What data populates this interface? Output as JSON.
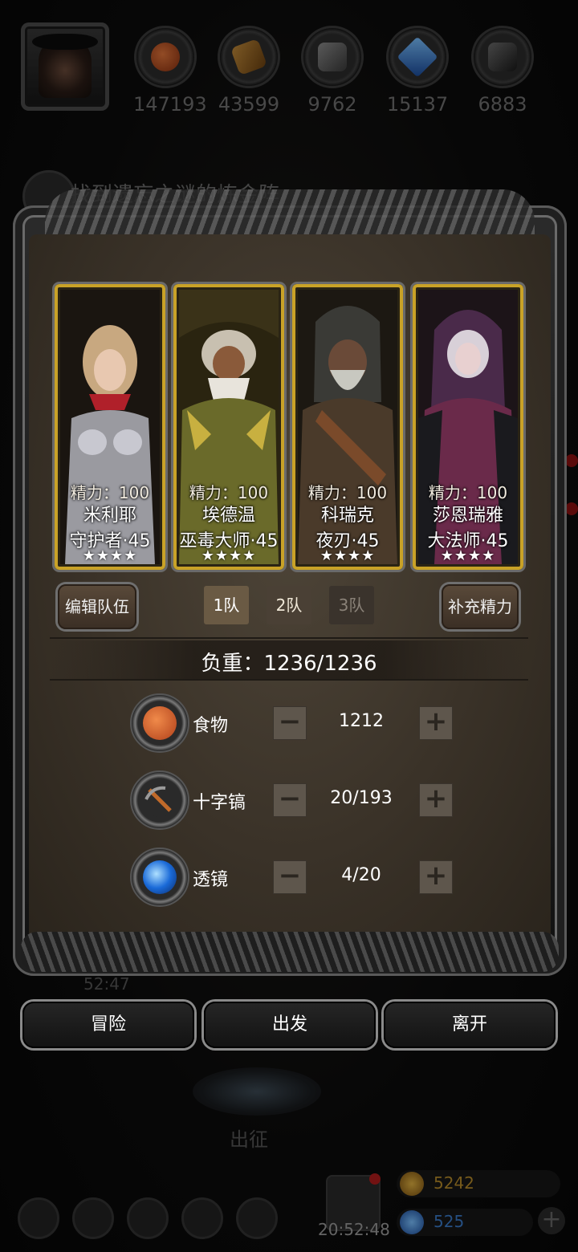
{
  "resources": [
    {
      "name": "food-icon",
      "value": "147193",
      "color": "#c4521e"
    },
    {
      "name": "wood-icon",
      "value": "43599",
      "color": "#9a6a2a"
    },
    {
      "name": "stone-icon",
      "value": "9762",
      "color": "#6a6a6a"
    },
    {
      "name": "crystal-icon",
      "value": "15137",
      "color": "#3a8ad8"
    },
    {
      "name": "iron-icon",
      "value": "6883",
      "color": "#4a4a4a"
    }
  ],
  "quest": {
    "text": "找到遗忘之谜的炼金阵"
  },
  "heroes": [
    {
      "energy": "精力：100",
      "name": "米利耶",
      "class_level": "守护者·45",
      "stars": "★★★★"
    },
    {
      "energy": "精力：100",
      "name": "埃德温",
      "class_level": "巫毒大师·45",
      "stars": "★★★★"
    },
    {
      "energy": "精力：100",
      "name": "科瑞克",
      "class_level": "夜刃·45",
      "stars": "★★★★"
    },
    {
      "energy": "精力：100",
      "name": "莎恩瑞雅",
      "class_level": "大法师·45",
      "stars": "★★★★"
    }
  ],
  "team": {
    "edit_label": "编辑队伍",
    "tabs": [
      "1队",
      "2队",
      "3队"
    ],
    "selected": "1队",
    "refill_label": "补充精力"
  },
  "load": {
    "text": "负重：1236/1236"
  },
  "items": [
    {
      "label": "食物",
      "qty": "1212",
      "icon": "food-icon"
    },
    {
      "label": "十字镐",
      "qty": "20/193",
      "icon": "pickaxe-icon"
    },
    {
      "label": "透镜",
      "qty": "4/20",
      "icon": "lens-icon"
    }
  ],
  "stepper": {
    "minus": "−",
    "plus": "+"
  },
  "actions": {
    "adventure": "冒险",
    "depart": "出发",
    "leave": "离开"
  },
  "background": {
    "timer_top": "52:47",
    "expedition": "出征",
    "timer_bottom": "20:52:48",
    "gold": "5242",
    "gems": "525",
    "add": "+"
  },
  "colors": {
    "gold_frame": "#c9a227",
    "gold_text": "#b58a2a",
    "gem_text": "#3a7ac8"
  }
}
